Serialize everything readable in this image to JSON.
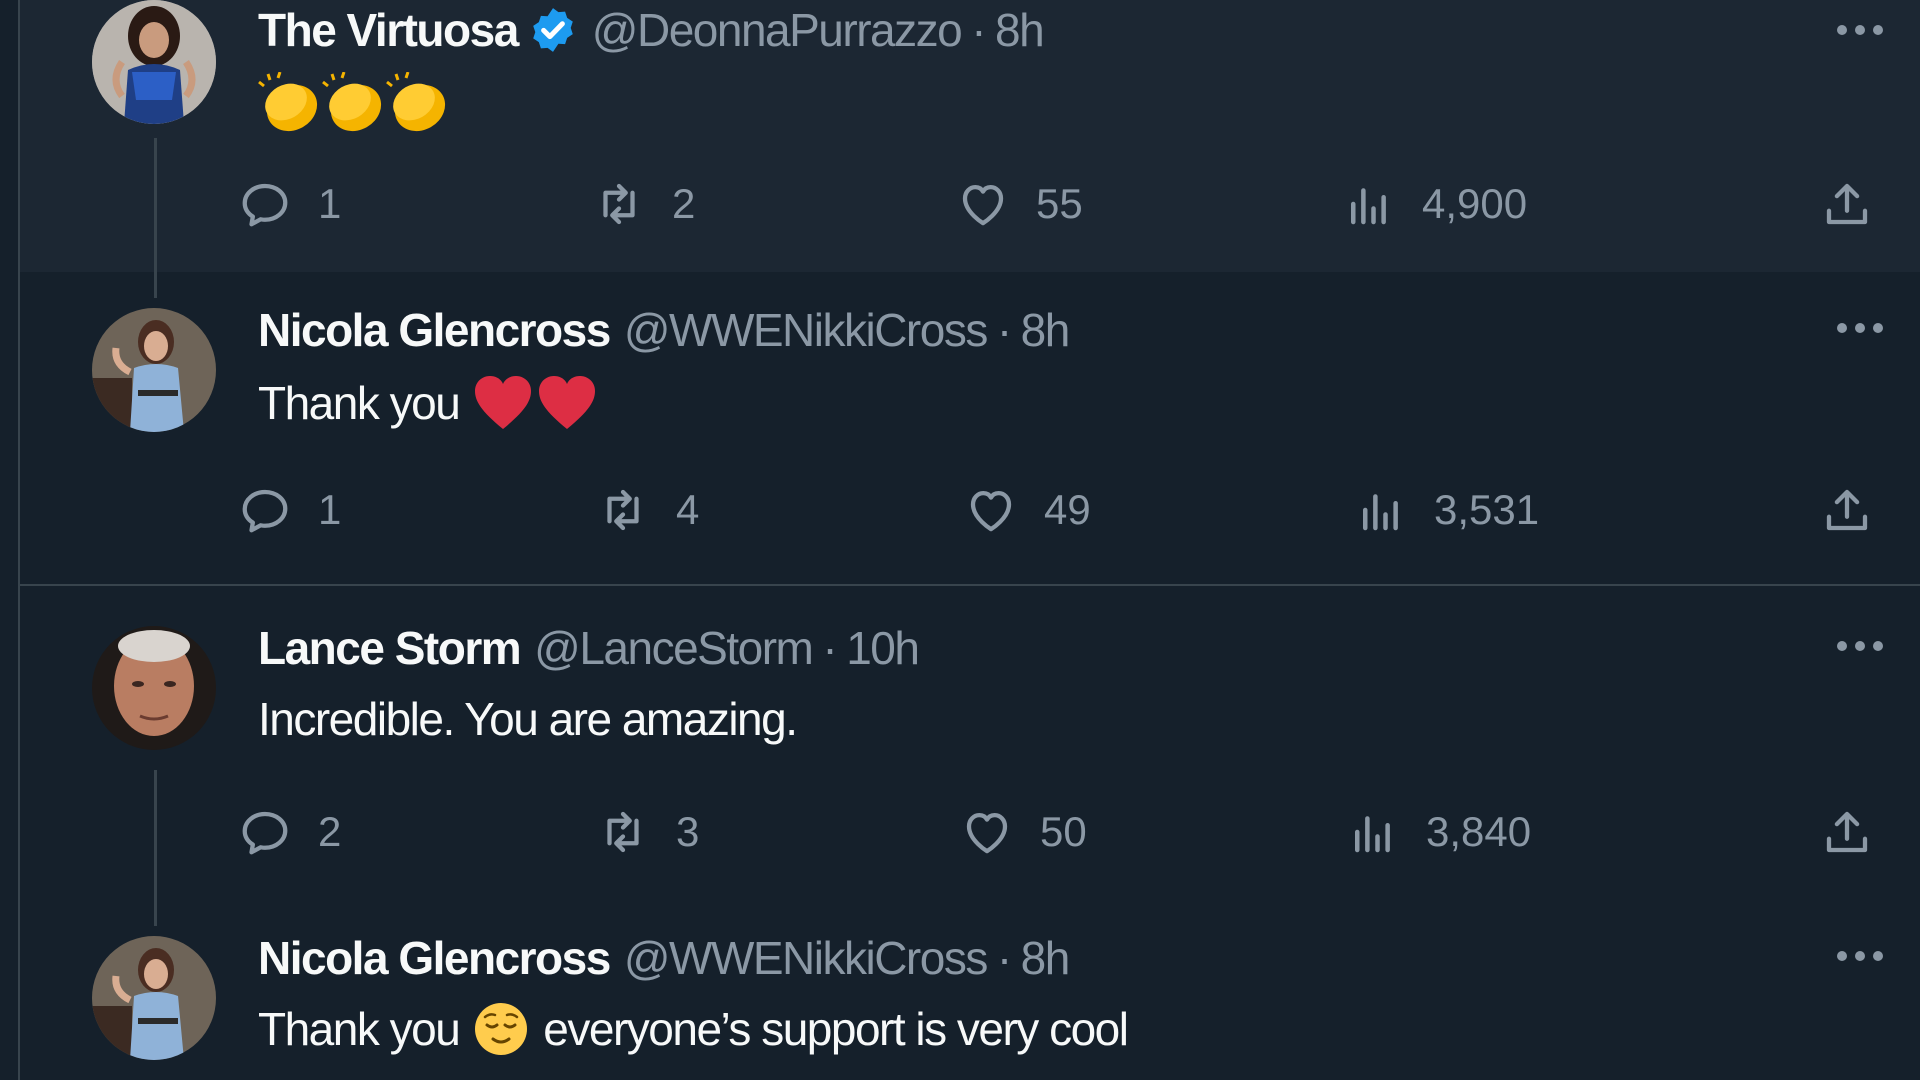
{
  "tweets": [
    {
      "display_name": "The Virtuosa",
      "verified": true,
      "handle": "@DeonnaPurrazzo",
      "separator": "·",
      "time": "8h",
      "text": "",
      "emojis": [
        "clapping-hands",
        "clapping-hands",
        "clapping-hands"
      ],
      "replies": "1",
      "retweets": "2",
      "likes": "55",
      "views": "4,900"
    },
    {
      "display_name": "Nicola Glencross",
      "verified": false,
      "handle": "@WWENikkiCross",
      "separator": "·",
      "time": "8h",
      "text": "Thank you",
      "emojis": [
        "red-heart",
        "red-heart"
      ],
      "replies": "1",
      "retweets": "4",
      "likes": "49",
      "views": "3,531"
    },
    {
      "display_name": "Lance Storm",
      "verified": false,
      "handle": "@LanceStorm",
      "separator": "·",
      "time": "10h",
      "text": "Incredible. You are amazing.",
      "replies": "2",
      "retweets": "3",
      "likes": "50",
      "views": "3,840"
    },
    {
      "display_name": "Nicola Glencross",
      "verified": false,
      "handle": "@WWENikkiCross",
      "separator": "·",
      "time": "8h",
      "text_before": "Thank you",
      "emoji": "relieved-face",
      "text_after": "everyone’s support is very cool"
    }
  ],
  "icons": {
    "reply": "reply-icon",
    "retweet": "retweet-icon",
    "like": "heart-icon",
    "views": "views-icon",
    "share": "share-icon",
    "more": "more-icon",
    "verified": "verified-badge-icon"
  },
  "colors": {
    "background": "#15202b",
    "highlight_background": "#1c2733",
    "text_primary": "#f7f9f9",
    "text_secondary": "#8b98a5",
    "border": "#38444d",
    "verified_blue": "#1d9bf0"
  }
}
